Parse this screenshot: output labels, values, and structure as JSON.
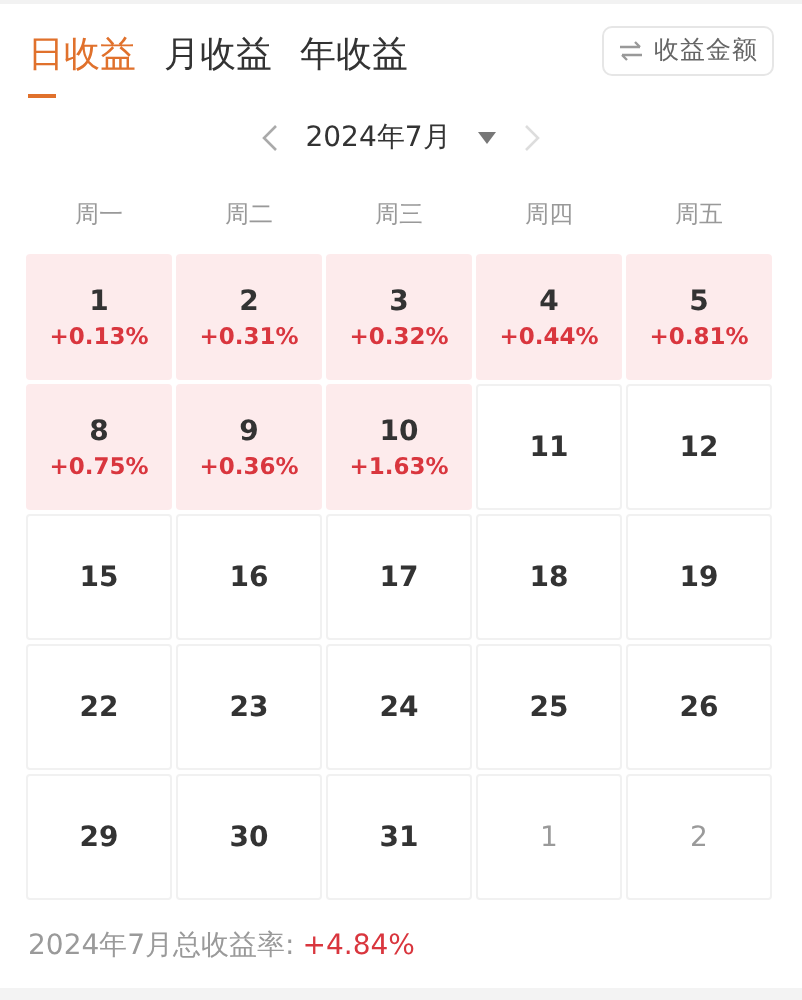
{
  "tabs": [
    {
      "label": "日收益",
      "selected": true
    },
    {
      "label": "月收益",
      "selected": false
    },
    {
      "label": "年收益",
      "selected": false
    }
  ],
  "toggle_button": {
    "label": "收益金额"
  },
  "month_selector": {
    "label": "2024年7月"
  },
  "weekdays": [
    "周一",
    "周二",
    "周三",
    "周四",
    "周五"
  ],
  "days": [
    {
      "day": "1",
      "kind": "gain",
      "change": "+0.13%"
    },
    {
      "day": "2",
      "kind": "gain",
      "change": "+0.31%"
    },
    {
      "day": "3",
      "kind": "gain",
      "change": "+0.32%"
    },
    {
      "day": "4",
      "kind": "gain",
      "change": "+0.44%"
    },
    {
      "day": "5",
      "kind": "gain",
      "change": "+0.81%"
    },
    {
      "day": "8",
      "kind": "gain",
      "change": "+0.75%"
    },
    {
      "day": "9",
      "kind": "gain",
      "change": "+0.36%"
    },
    {
      "day": "10",
      "kind": "gain",
      "change": "+1.63%"
    },
    {
      "day": "11",
      "kind": "plain"
    },
    {
      "day": "12",
      "kind": "plain"
    },
    {
      "day": "15",
      "kind": "plain"
    },
    {
      "day": "16",
      "kind": "plain"
    },
    {
      "day": "17",
      "kind": "plain"
    },
    {
      "day": "18",
      "kind": "plain"
    },
    {
      "day": "19",
      "kind": "plain"
    },
    {
      "day": "22",
      "kind": "plain"
    },
    {
      "day": "23",
      "kind": "plain"
    },
    {
      "day": "24",
      "kind": "plain"
    },
    {
      "day": "25",
      "kind": "plain"
    },
    {
      "day": "26",
      "kind": "plain"
    },
    {
      "day": "29",
      "kind": "plain"
    },
    {
      "day": "30",
      "kind": "plain"
    },
    {
      "day": "31",
      "kind": "plain"
    },
    {
      "day": "1",
      "kind": "other"
    },
    {
      "day": "2",
      "kind": "other"
    }
  ],
  "summary": {
    "label": "2024年7月总收益率:",
    "value": "+4.84%"
  }
}
